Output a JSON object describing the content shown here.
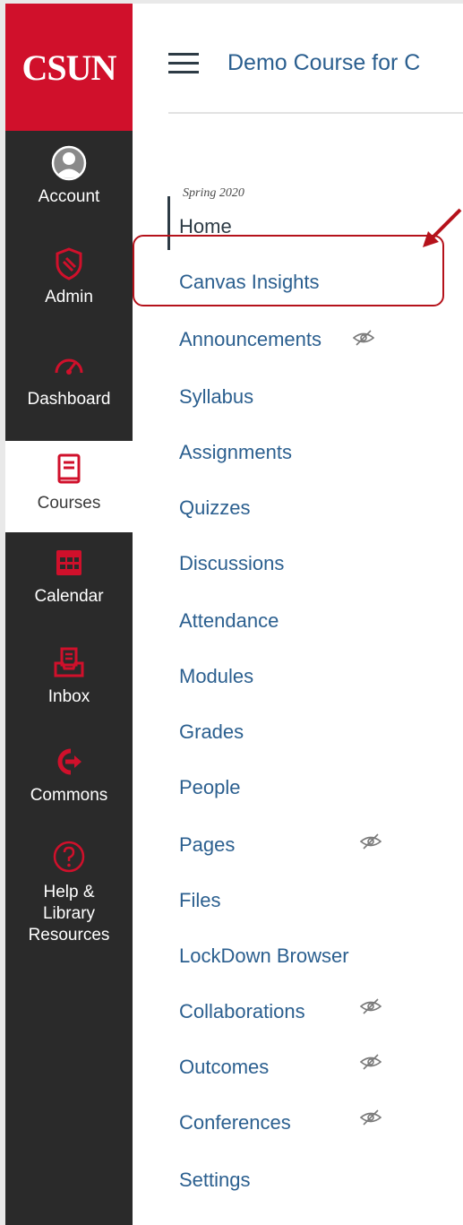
{
  "global_nav": {
    "logo": "CSUN",
    "items": [
      {
        "label": "Account",
        "icon": "user-avatar-icon"
      },
      {
        "label": "Admin",
        "icon": "shield-icon"
      },
      {
        "label": "Dashboard",
        "icon": "speedometer-icon"
      },
      {
        "label": "Courses",
        "icon": "book-icon",
        "active": true
      },
      {
        "label": "Calendar",
        "icon": "calendar-icon"
      },
      {
        "label": "Inbox",
        "icon": "inbox-icon"
      },
      {
        "label": "Commons",
        "icon": "commons-arrow-icon"
      },
      {
        "label": "Help &",
        "label2": "Library",
        "label3": "Resources",
        "icon": "question-circle-icon"
      }
    ]
  },
  "header": {
    "course_title": "Demo Course for C"
  },
  "course_nav": {
    "term": "Spring 2020",
    "items": [
      {
        "label": "Home",
        "active": true
      },
      {
        "label": "Canvas Insights"
      },
      {
        "label": "Announcements",
        "hidden": true
      },
      {
        "label": "Syllabus"
      },
      {
        "label": "Assignments"
      },
      {
        "label": "Quizzes"
      },
      {
        "label": "Discussions"
      },
      {
        "label": "Attendance"
      },
      {
        "label": "Modules"
      },
      {
        "label": "Grades"
      },
      {
        "label": "People"
      },
      {
        "label": "Pages",
        "hidden": true
      },
      {
        "label": "Files"
      },
      {
        "label": "LockDown Browser"
      },
      {
        "label": "Collaborations",
        "hidden": true
      },
      {
        "label": "Outcomes",
        "hidden": true
      },
      {
        "label": "Conferences",
        "hidden": true
      },
      {
        "label": "Settings"
      }
    ]
  },
  "colors": {
    "brand_red": "#d0102b",
    "nav_dark": "#2a2a2a",
    "link_blue": "#2b5f8f",
    "annotation_red": "#b5121b"
  }
}
